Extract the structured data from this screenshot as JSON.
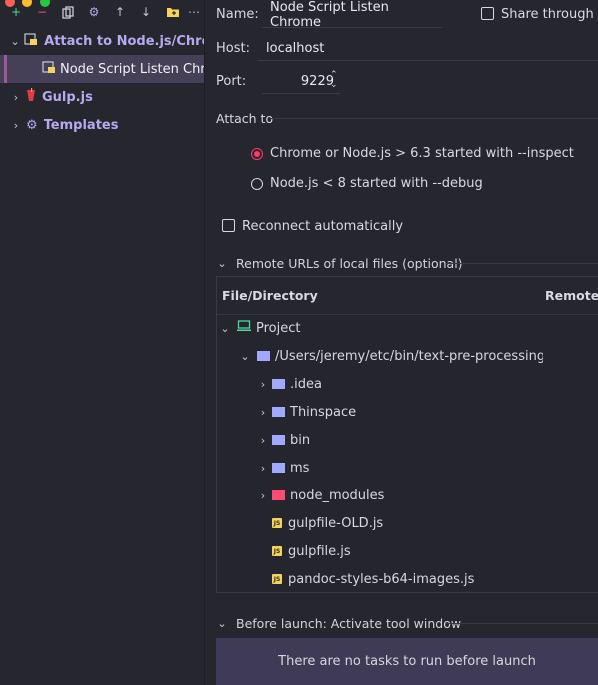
{
  "window": {
    "traffic_lights": [
      "#ff5f57",
      "#febc2e",
      "#28c840"
    ]
  },
  "toolbar": {
    "icons": [
      "add-icon",
      "remove-icon",
      "copy-icon",
      "settings-icon",
      "move-up-icon",
      "move-down-icon",
      "new-folder-icon",
      "more-icon"
    ]
  },
  "tree": {
    "items": [
      {
        "label": "Attach to Node.js/Chrome",
        "expanded": true
      },
      {
        "label": "Node Script Listen Chrome",
        "selected": true
      },
      {
        "label": "Gulp.js",
        "expanded": false
      },
      {
        "label": "Templates",
        "expanded": false
      }
    ]
  },
  "form": {
    "name_label": "Name:",
    "name_value": "Node Script Listen Chrome",
    "share_label": "Share through V",
    "host_label": "Host:",
    "host_value": "localhost",
    "port_label": "Port:",
    "port_value": "9229",
    "attach_to_label": "Attach to",
    "radio_options": [
      {
        "label": "Chrome or Node.js > 6.3 started with --inspect",
        "checked": true
      },
      {
        "label": "Node.js < 8 started with --debug",
        "checked": false
      }
    ],
    "reconnect_label": "Reconnect automatically"
  },
  "remote_urls": {
    "section_label": "Remote URLs of local files (optional)",
    "col_file": "File/Directory",
    "col_remote": "Remote",
    "rows": [
      {
        "label": "Project",
        "icon": "project-icon",
        "expanded": true
      },
      {
        "label": "/Users/jeremy/etc/bin/text-pre-processing/m",
        "icon": "folder-icon",
        "expanded": true
      },
      {
        "label": ".idea",
        "icon": "folder-icon"
      },
      {
        "label": "Thinspace",
        "icon": "folder-icon"
      },
      {
        "label": "bin",
        "icon": "folder-icon"
      },
      {
        "label": "ms",
        "icon": "folder-icon"
      },
      {
        "label": "node_modules",
        "icon": "folder-icon"
      },
      {
        "label": "gulpfile-OLD.js",
        "icon": "js-file-icon"
      },
      {
        "label": "gulpfile.js",
        "icon": "js-file-icon"
      },
      {
        "label": "pandoc-styles-b64-images.js",
        "icon": "js-file-icon"
      }
    ]
  },
  "before_launch": {
    "section_label": "Before launch: Activate tool window",
    "empty_text": "There are no tasks to run before launch"
  },
  "colors": {
    "accent": "#b7a9ef",
    "selected_bg": "#454058",
    "radio_checked": "#ff3b6b",
    "folder": "#a0a8ff",
    "node_modules_folder": "#ff4b72",
    "js_icon": "#f4d35e",
    "project_icon": "#4ad9a6"
  }
}
